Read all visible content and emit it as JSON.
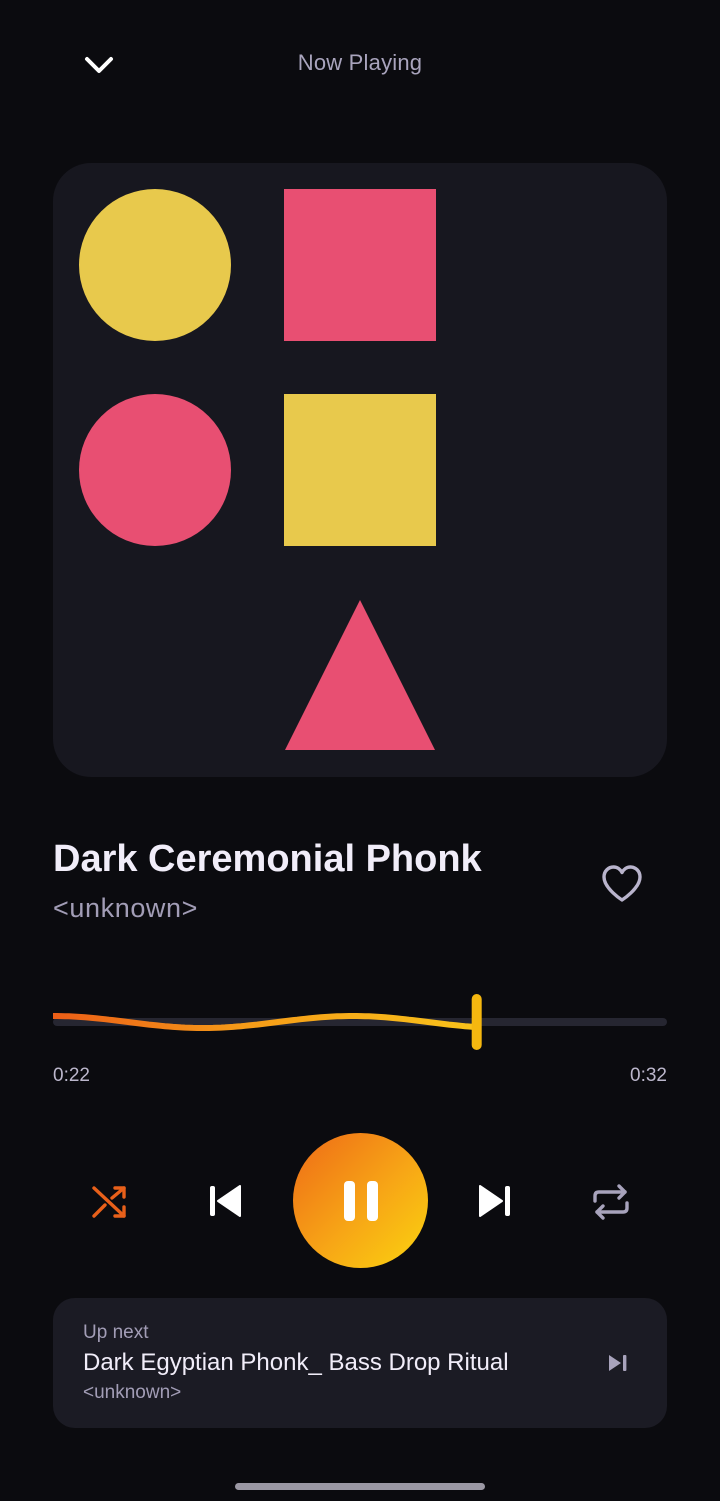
{
  "header": {
    "title": "Now Playing",
    "collapse_icon": "chevron-down-icon"
  },
  "artwork": {
    "description_icon": "album-art-shapes",
    "colors": {
      "background": "#17171f",
      "yellow": "#e8c94c",
      "pink": "#e84f72"
    }
  },
  "track": {
    "title": "Dark Ceremonial Phonk",
    "artist": "<unknown>",
    "favorite_icon": "heart-outline-icon"
  },
  "playback": {
    "elapsed": "0:22",
    "duration": "0:32",
    "progress_fraction": 0.69,
    "state": "playing"
  },
  "controls": {
    "shuffle_icon": "shuffle-icon",
    "previous_icon": "skip-previous-icon",
    "pause_icon": "pause-icon",
    "next_icon": "skip-next-icon",
    "repeat_icon": "repeat-icon",
    "accent_start": "#ee6a17",
    "accent_end": "#fbd40f"
  },
  "up_next": {
    "label": "Up next",
    "title": "Dark Egyptian Phonk_ Bass Drop Ritual",
    "artist": "<unknown>",
    "skip_icon": "skip-next-small-icon"
  }
}
